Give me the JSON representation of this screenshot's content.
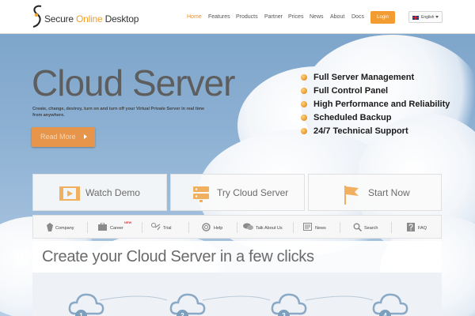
{
  "header": {
    "logo": {
      "text_main": "Secure ",
      "text_accent": "Online",
      "text_end": " Desktop"
    },
    "nav": [
      {
        "label": "Home",
        "active": true
      },
      {
        "label": "Features",
        "active": false
      },
      {
        "label": "Products",
        "active": false
      },
      {
        "label": "Partner",
        "active": false
      },
      {
        "label": "Prices",
        "active": false
      },
      {
        "label": "News",
        "active": false
      },
      {
        "label": "About",
        "active": false
      },
      {
        "label": "Docs",
        "active": false
      }
    ],
    "login_label": "Login",
    "language": {
      "label": "English",
      "flag": "uk-flag-icon"
    }
  },
  "hero": {
    "title": "Cloud Server",
    "subtitle": "Create, change, destroy, turn on and turn off your Virtual Private Server in real time from anywhere.",
    "read_more_label": "Read More",
    "features": [
      "Full Server Management",
      "Full Control Panel",
      "High Performance and Reliability",
      "Scheduled Backup",
      "24/7 Technical Support"
    ]
  },
  "cta": [
    {
      "label": "Watch Demo",
      "icon": "video-icon"
    },
    {
      "label": "Try Cloud Server",
      "icon": "server-icon"
    },
    {
      "label": "Start Now",
      "icon": "flag-icon"
    }
  ],
  "subnav": {
    "items": [
      {
        "label": "Company",
        "icon": "company-icon"
      },
      {
        "label": "Career",
        "icon": "briefcase-icon"
      },
      {
        "label": "Trial",
        "icon": "trial-icon"
      },
      {
        "label": "Help",
        "icon": "lifebuoy-icon"
      },
      {
        "label": "Talk About Us",
        "icon": "chat-icon"
      },
      {
        "label": "News",
        "icon": "news-icon"
      },
      {
        "label": "Search",
        "icon": "search-icon"
      },
      {
        "label": "FAQ",
        "icon": "faq-icon"
      }
    ],
    "new_badge": "NEW"
  },
  "steps": {
    "title": "Create your Cloud Server in a few clicks",
    "numbers": [
      "1",
      "2",
      "3",
      "4"
    ]
  },
  "colors": {
    "accent": "#ef8d1b",
    "button": "#f39c32",
    "sky": "#7fa6cc"
  }
}
